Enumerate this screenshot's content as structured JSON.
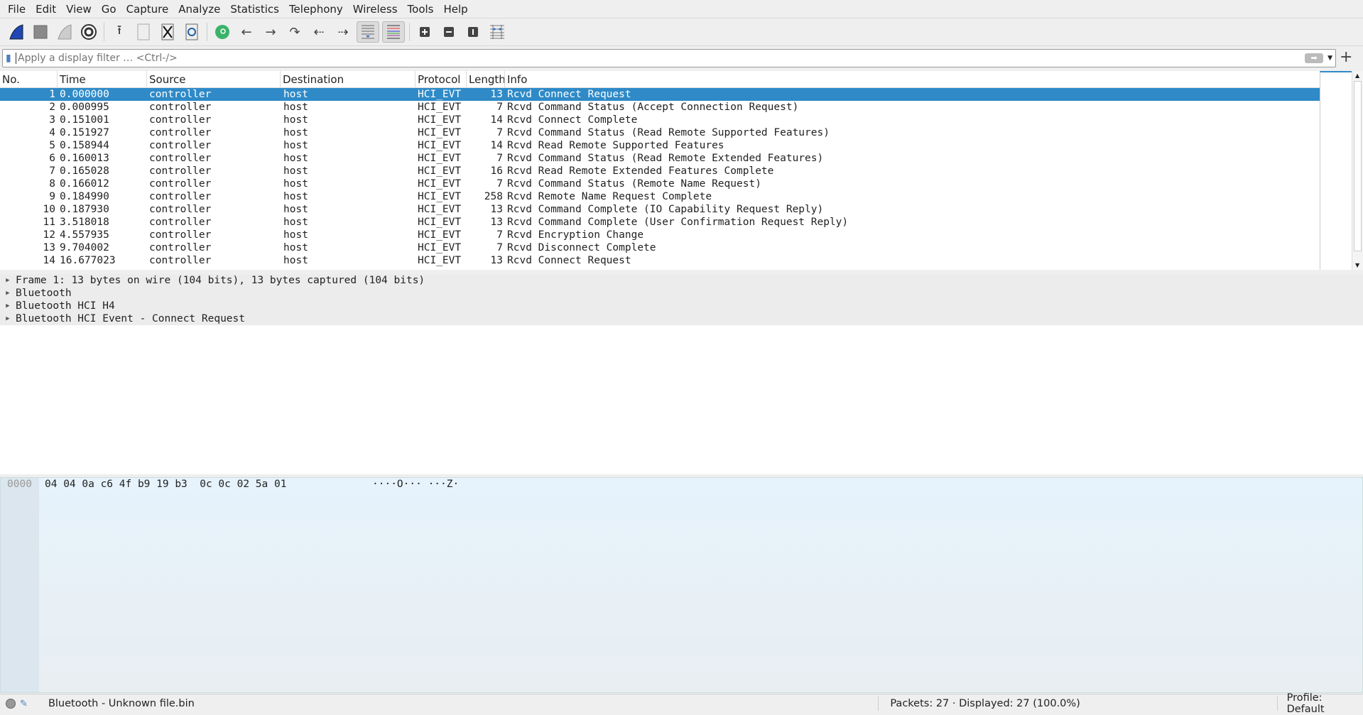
{
  "menu": [
    "File",
    "Edit",
    "View",
    "Go",
    "Capture",
    "Analyze",
    "Statistics",
    "Telephony",
    "Wireless",
    "Tools",
    "Help"
  ],
  "toolbar": {
    "icons": [
      "start-capture-icon",
      "stop-capture-icon",
      "restart-capture-icon",
      "capture-options-icon",
      "open-file-icon",
      "save-file-icon",
      "close-file-icon",
      "reload-file-icon",
      "find-packet-icon",
      "go-back-icon",
      "go-forward-icon",
      "go-to-packet-icon",
      "first-packet-icon",
      "last-packet-icon",
      "autoscroll-icon",
      "colorize-icon",
      "zoom-in-icon",
      "zoom-out-icon",
      "normal-size-icon",
      "resize-columns-icon"
    ]
  },
  "filter": {
    "placeholder": "Apply a display filter … <Ctrl-/>",
    "value": ""
  },
  "columns": [
    "No.",
    "Time",
    "Source",
    "Destination",
    "Protocol",
    "Length",
    "Info"
  ],
  "packets": [
    [
      "1",
      "0.000000",
      "controller",
      "host",
      "HCI_EVT",
      "13",
      "Rcvd Connect Request"
    ],
    [
      "2",
      "0.000995",
      "controller",
      "host",
      "HCI_EVT",
      "7",
      "Rcvd Command Status (Accept Connection Request)"
    ],
    [
      "3",
      "0.151001",
      "controller",
      "host",
      "HCI_EVT",
      "14",
      "Rcvd Connect Complete"
    ],
    [
      "4",
      "0.151927",
      "controller",
      "host",
      "HCI_EVT",
      "7",
      "Rcvd Command Status (Read Remote Supported Features)"
    ],
    [
      "5",
      "0.158944",
      "controller",
      "host",
      "HCI_EVT",
      "14",
      "Rcvd Read Remote Supported Features"
    ],
    [
      "6",
      "0.160013",
      "controller",
      "host",
      "HCI_EVT",
      "7",
      "Rcvd Command Status (Read Remote Extended Features)"
    ],
    [
      "7",
      "0.165028",
      "controller",
      "host",
      "HCI_EVT",
      "16",
      "Rcvd Read Remote Extended Features Complete"
    ],
    [
      "8",
      "0.166012",
      "controller",
      "host",
      "HCI_EVT",
      "7",
      "Rcvd Command Status (Remote Name Request)"
    ],
    [
      "9",
      "0.184990",
      "controller",
      "host",
      "HCI_EVT",
      "258",
      "Rcvd Remote Name Request Complete"
    ],
    [
      "10",
      "0.187930",
      "controller",
      "host",
      "HCI_EVT",
      "13",
      "Rcvd Command Complete (IO Capability Request Reply)"
    ],
    [
      "11",
      "3.518018",
      "controller",
      "host",
      "HCI_EVT",
      "13",
      "Rcvd Command Complete (User Confirmation Request Reply)"
    ],
    [
      "12",
      "4.557935",
      "controller",
      "host",
      "HCI_EVT",
      "7",
      "Rcvd Encryption Change"
    ],
    [
      "13",
      "9.704002",
      "controller",
      "host",
      "HCI_EVT",
      "7",
      "Rcvd Disconnect Complete"
    ],
    [
      "14",
      "16.677023",
      "controller",
      "host",
      "HCI_EVT",
      "13",
      "Rcvd Connect Request"
    ]
  ],
  "selected_packet": "1",
  "details": [
    "Frame 1: 13 bytes on wire (104 bits), 13 bytes captured (104 bits)",
    "Bluetooth",
    "Bluetooth HCI H4",
    "Bluetooth HCI Event - Connect Request"
  ],
  "bytes": {
    "offset": "0000",
    "hex": "04 04 0a c6 4f b9 19 b3  0c 0c 02 5a 01",
    "ascii": "····O··· ···Z·"
  },
  "status": {
    "file": "Bluetooth - Unknown file.bin",
    "packets": "Packets: 27 · Displayed: 27 (100.0%)",
    "profile": "Profile: Default"
  },
  "colors": {
    "selection": "#2f8ac7",
    "bytes_bg": "#e6f3fc"
  }
}
